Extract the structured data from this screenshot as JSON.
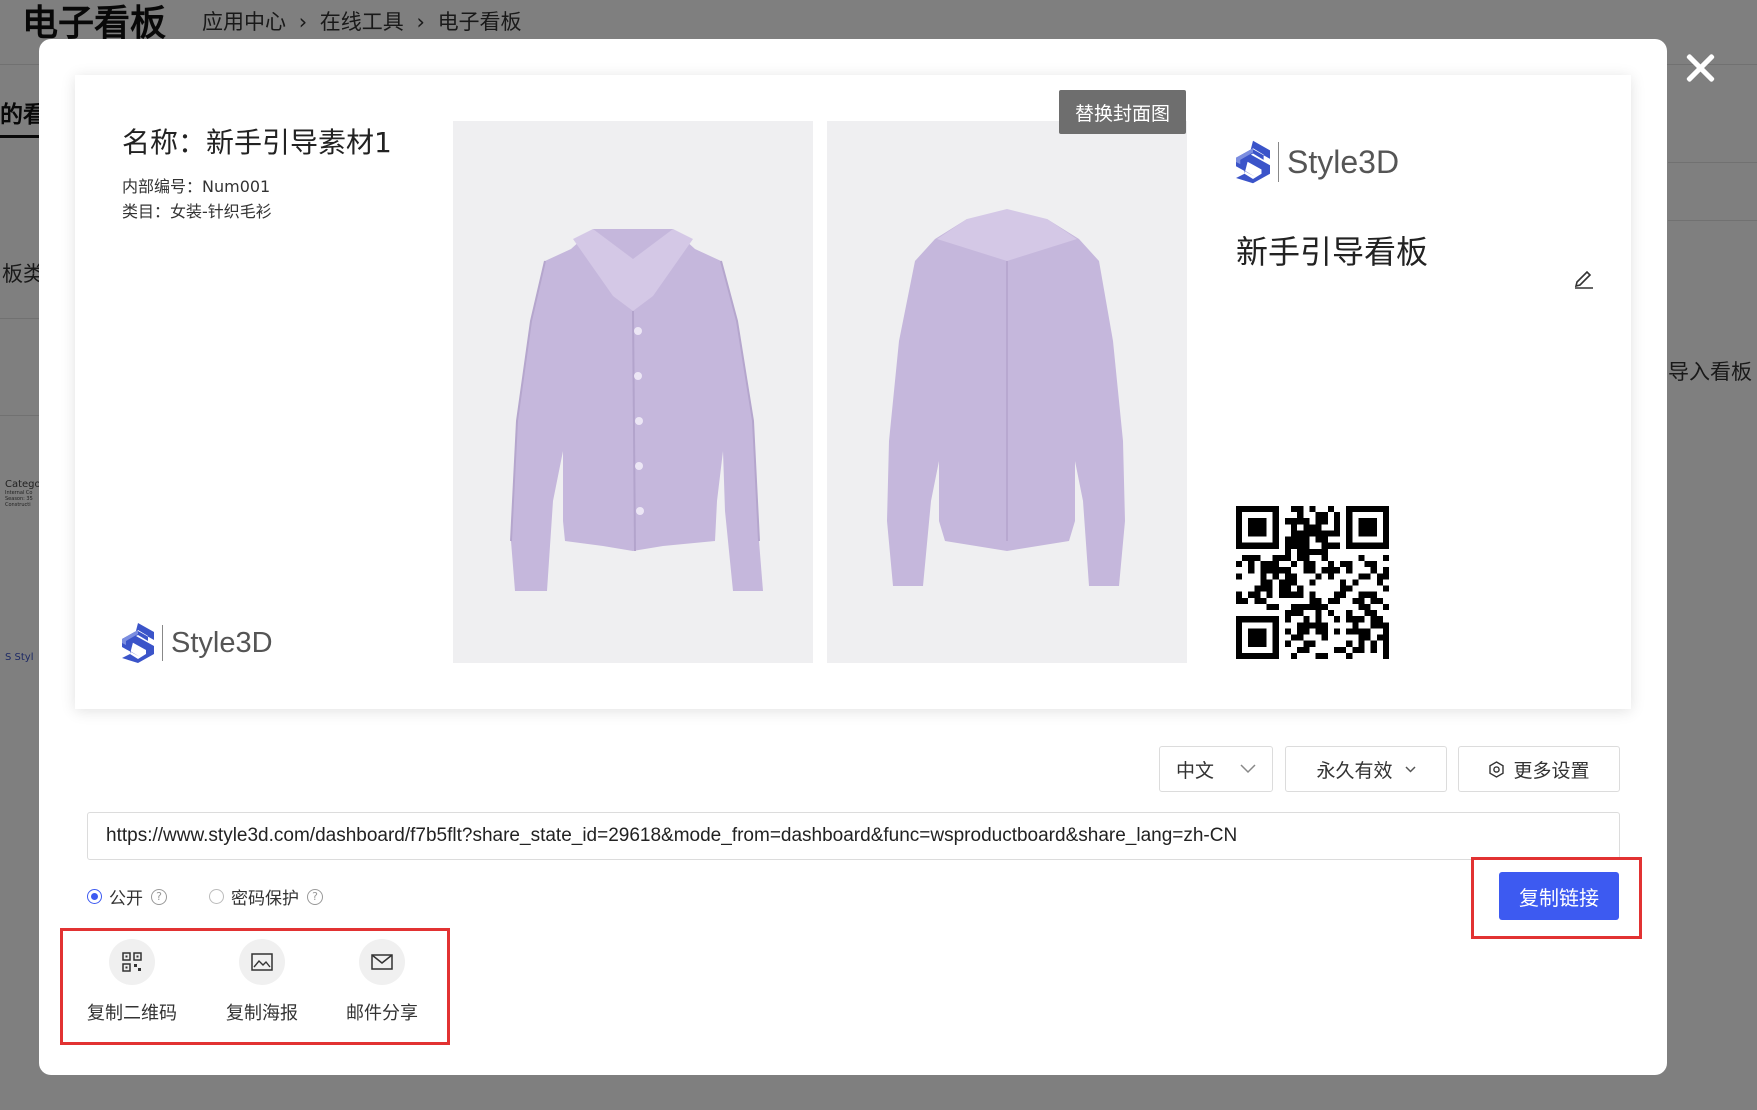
{
  "background_page": {
    "title": "电子看板",
    "breadcrumb": [
      "应用中心",
      "›",
      "在线工具",
      "›",
      "电子看板"
    ],
    "tab_partial": "的看",
    "category_partial": "板类",
    "right_action_partial": "导入看板",
    "thumb_text_lines": [
      "Catego",
      "Internal Co",
      "Season: 35",
      "Constructi"
    ],
    "thumb_logo_partial": "Styl"
  },
  "modal": {
    "close_icon": "close-icon",
    "card": {
      "name": "名称：新手引导素材1",
      "internal_code": "内部编号：Num001",
      "category": "类目：女装-针织毛衫",
      "brand_left": "Style3D",
      "brand_right": "Style3D",
      "replace_cover_label": "替换封面图",
      "board_title": "新手引导看板",
      "edit_icon": "edit-pen-icon",
      "garment_color": "#c5b7dc",
      "photo_bg": "#efeff1"
    },
    "controls": {
      "language": {
        "selected": "中文"
      },
      "validity": {
        "selected": "永久有效"
      },
      "more_settings_label": "更多设置"
    },
    "share_url": "https://www.style3d.com/dashboard/f7b5flt?share_state_id=29618&mode_from=dashboard&func=wsproductboard&share_lang=zh-CN",
    "access": {
      "public_label": "公开",
      "password_label": "密码保护",
      "selected": "public",
      "help_glyph": "?"
    },
    "copy_link_label": "复制链接",
    "share_actions": [
      {
        "label": "复制二维码",
        "icon": "qr-code-icon"
      },
      {
        "label": "复制海报",
        "icon": "image-icon"
      },
      {
        "label": "邮件分享",
        "icon": "mail-icon"
      }
    ],
    "colors": {
      "accent": "#3d5af1",
      "highlight": "#e23232",
      "brand_blue": "#3b54c9"
    }
  }
}
